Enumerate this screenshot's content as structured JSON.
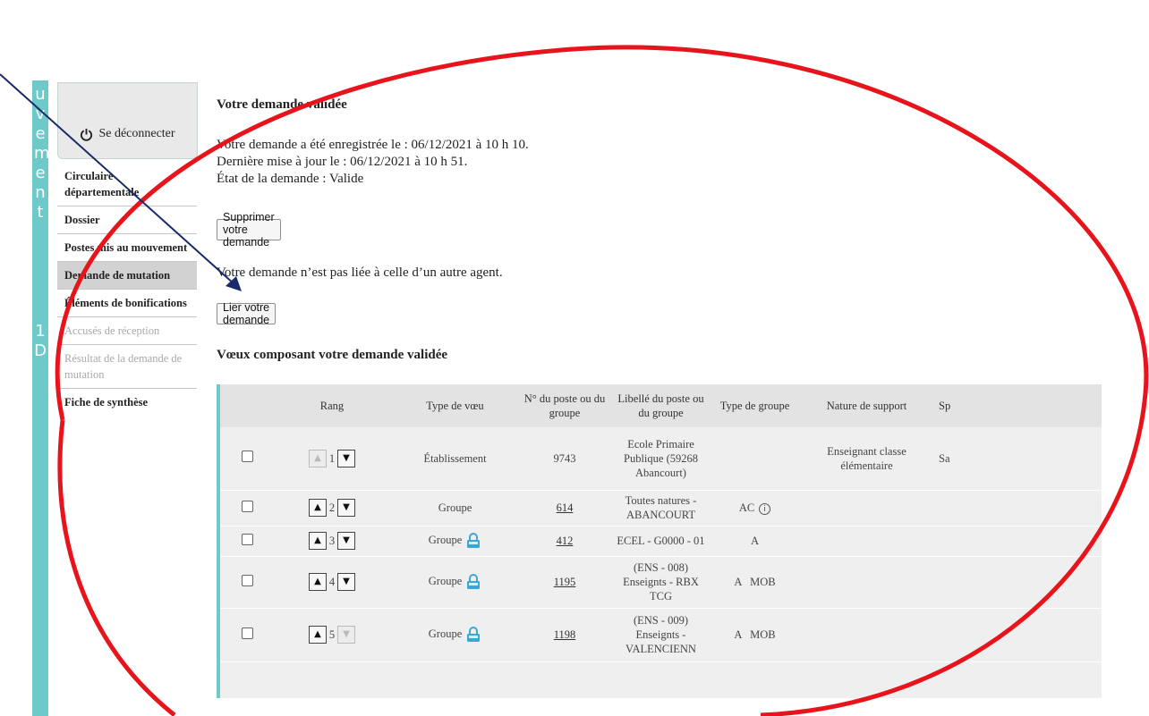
{
  "vertical_band": {
    "letters": [
      "u",
      "v",
      "e",
      "m",
      "e",
      "n",
      "t",
      "",
      "1",
      "D"
    ]
  },
  "sidebar": {
    "logout_label": "Se déconnecter",
    "items": [
      {
        "label": "Circulaire départementale",
        "state": "bold"
      },
      {
        "label": "Dossier",
        "state": "bold"
      },
      {
        "label": "Postes mis au mouvement",
        "state": "bold"
      },
      {
        "label": "Demande de mutation",
        "state": "active"
      },
      {
        "label": "Éléments de bonifications",
        "state": "bold"
      },
      {
        "label": "Accusés de réception",
        "state": "disabled"
      },
      {
        "label": "Résultat de la demande de mutation",
        "state": "disabled"
      },
      {
        "label": "Fiche de synthèse",
        "state": "bold"
      }
    ]
  },
  "main": {
    "title": "Votre demande validée",
    "registered": "Votre demande a été enregistrée le : 06/12/2021 à 10 h 10.",
    "updated": "Dernière mise à jour le : 06/12/2021 à 10 h 51.",
    "state": "État de la demande : Valide",
    "delete_button": "Supprimer votre demande",
    "link_text": "Votre demande n’est pas liée à celle d’un autre agent.",
    "link_button": "Lier votre demande",
    "voeux_title": "Vœux composant votre demande validée"
  },
  "table": {
    "headers": [
      "Rang",
      "Type de vœu",
      "N° du poste ou du groupe",
      "Libellé du poste ou du groupe",
      "Type de groupe",
      "Nature de support",
      "Sp"
    ],
    "rows": [
      {
        "rank": "1",
        "type": "Établissement",
        "lock": false,
        "number": "9743",
        "number_link": false,
        "label": "Ecole Primaire Publique (59268 Abancourt)",
        "group_type": "",
        "info": false,
        "support": "Enseignant classe élémentaire",
        "sp": "Sa",
        "up_enabled": false,
        "down_enabled": true
      },
      {
        "rank": "2",
        "type": "Groupe",
        "lock": false,
        "number": "614",
        "number_link": true,
        "label": "Toutes natures - ABANCOURT",
        "group_type": "AC",
        "info": true,
        "support": "",
        "sp": "",
        "up_enabled": true,
        "down_enabled": true
      },
      {
        "rank": "3",
        "type": "Groupe",
        "lock": true,
        "number": "412",
        "number_link": true,
        "label": "ECEL - G0000 - 01",
        "group_type": "A",
        "info": false,
        "support": "",
        "sp": "",
        "up_enabled": true,
        "down_enabled": true
      },
      {
        "rank": "4",
        "type": "Groupe",
        "lock": true,
        "number": "1195",
        "number_link": true,
        "label": "(ENS - 008) Enseignts - RBX TCG",
        "group_type": "A   MOB",
        "info": false,
        "support": "",
        "sp": "",
        "up_enabled": true,
        "down_enabled": true
      },
      {
        "rank": "5",
        "type": "Groupe",
        "lock": true,
        "number": "1198",
        "number_link": true,
        "label": "(ENS - 009) Enseignts - VALENCIENN",
        "group_type": "A   MOB",
        "info": false,
        "support": "",
        "sp": "",
        "up_enabled": true,
        "down_enabled": false
      }
    ]
  },
  "colors": {
    "accent": "#6ec9c9",
    "annotation_ellipse": "#e8141b",
    "annotation_arrow": "#1a2a6b"
  },
  "icons": [
    "power-icon",
    "lock-icon",
    "info-icon",
    "arrow-up-icon",
    "arrow-down-icon"
  ]
}
